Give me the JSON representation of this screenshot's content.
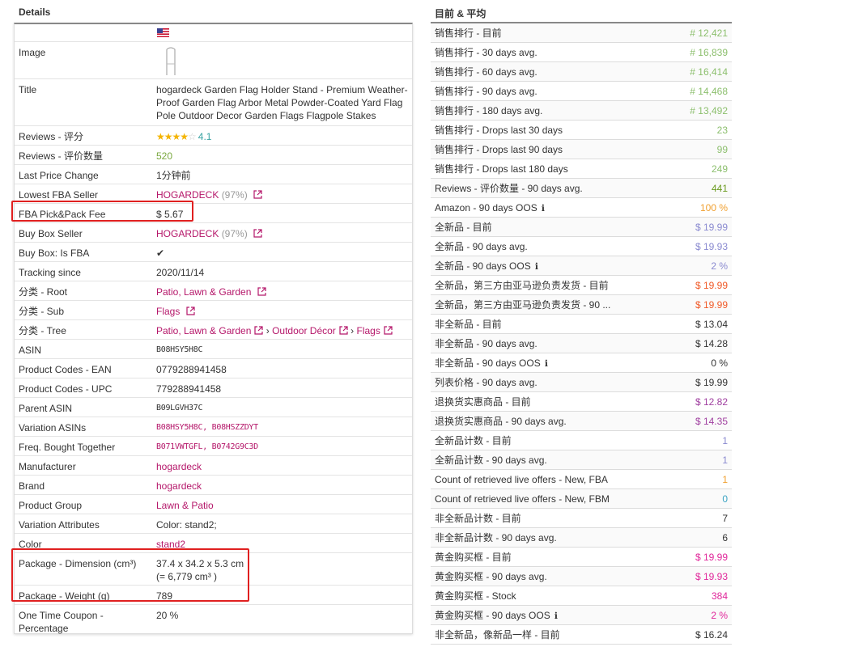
{
  "left": {
    "heading": "Details",
    "rows": [
      {
        "label": "",
        "value": ""
      },
      {
        "label": "Image",
        "value": ""
      },
      {
        "label": "Title",
        "value": "hogardeck Garden Flag Holder Stand - Premium Weather-Proof Garden Flag Arbor Metal Powder-Coated Yard Flag Pole Outdoor Decor Garden Flags Flagpole Stakes"
      },
      {
        "label": "Reviews - 评分",
        "value": "4.1",
        "stars": "★★★★",
        "stars_off": "☆"
      },
      {
        "label": "Reviews - 评价数量",
        "value": "520"
      },
      {
        "label": "Last Price Change",
        "value": "1分钟前"
      },
      {
        "label": "Lowest FBA Seller",
        "value": "HOGARDECK",
        "extra": "(97%)"
      },
      {
        "label": "FBA Pick&Pack Fee",
        "value": "$ 5.67"
      },
      {
        "label": "Buy Box Seller",
        "value": "HOGARDECK",
        "extra": "(97%)"
      },
      {
        "label": "Buy Box: Is FBA",
        "value": "✔"
      },
      {
        "label": "Tracking since",
        "value": "2020/11/14"
      },
      {
        "label": "分类 - Root",
        "value": "Patio, Lawn & Garden"
      },
      {
        "label": "分类 - Sub",
        "value": "Flags"
      },
      {
        "label": "分类 - Tree",
        "value": "Patio, Lawn & Garden",
        "value2": "Outdoor Décor",
        "value3": "Flags",
        "sep": "›"
      },
      {
        "label": "ASIN",
        "value": "B08HSY5H8C"
      },
      {
        "label": "Product Codes - EAN",
        "value": "0779288941458"
      },
      {
        "label": "Product Codes - UPC",
        "value": "779288941458"
      },
      {
        "label": "Parent ASIN",
        "value": "B09LGVH37C"
      },
      {
        "label": "Variation ASINs",
        "value": "B08HSY5H8C, B08HSZZDYT"
      },
      {
        "label": "Freq. Bought Together",
        "value": "B071VWTGFL, B0742G9C3D"
      },
      {
        "label": "Manufacturer",
        "value": "hogardeck"
      },
      {
        "label": "Brand",
        "value": "hogardeck"
      },
      {
        "label": "Product Group",
        "value": "Lawn & Patio"
      },
      {
        "label": "Variation Attributes",
        "value": "Color: stand2;"
      },
      {
        "label": "Color",
        "value": "stand2"
      },
      {
        "label": "Package - Dimension (cm³)",
        "value": "37.4 x 34.2 x 5.3 cm",
        "value_line2": "(= 6,779 cm³ )"
      },
      {
        "label": "Package - Weight (g)",
        "value": "789"
      },
      {
        "label": "One Time Coupon - Percentage",
        "value": "20 %"
      }
    ]
  },
  "right": {
    "heading": "目前 & 平均",
    "rows": [
      {
        "label": "销售排行 - 目前",
        "value": "# 12,421",
        "color": "#8cbf6d"
      },
      {
        "label": "销售排行 - 30 days avg.",
        "value": "# 16,839",
        "color": "#8cbf6d"
      },
      {
        "label": "销售排行 - 60 days avg.",
        "value": "# 16,414",
        "color": "#8cbf6d"
      },
      {
        "label": "销售排行 - 90 days avg.",
        "value": "# 14,468",
        "color": "#8cbf6d"
      },
      {
        "label": "销售排行 - 180 days avg.",
        "value": "# 13,492",
        "color": "#8cbf6d"
      },
      {
        "label": "销售排行 - Drops last 30 days",
        "value": "23",
        "color": "#8cbf6d"
      },
      {
        "label": "销售排行 - Drops last 90 days",
        "value": "99",
        "color": "#8cbf6d"
      },
      {
        "label": "销售排行 - Drops last 180 days",
        "value": "249",
        "color": "#8cbf6d"
      },
      {
        "label": "Reviews - 评价数量 - 90 days avg.",
        "value": "441",
        "color": "#6a9a1f"
      },
      {
        "label": "Amazon - 90 days OOS",
        "value": "100 %",
        "color": "#f0a030",
        "info": "ℹ"
      },
      {
        "label": "全新品 - 目前",
        "value": "$ 19.99",
        "color": "#8a8ad0"
      },
      {
        "label": "全新品 - 90 days avg.",
        "value": "$ 19.93",
        "color": "#8a8ad0"
      },
      {
        "label": "全新品 - 90 days OOS",
        "value": "2 %",
        "color": "#8a8ad0",
        "info": "ℹ"
      },
      {
        "label": "全新品，第三方由亚马逊负责发货 - 目前",
        "value": "$ 19.99",
        "color": "#f05a28"
      },
      {
        "label": "全新品，第三方由亚马逊负责发货 - 90 ...",
        "value": "$ 19.99",
        "color": "#f05a28"
      },
      {
        "label": "非全新品 - 目前",
        "value": "$ 13.04",
        "color": "#333333"
      },
      {
        "label": "非全新品 - 90 days avg.",
        "value": "$ 14.28",
        "color": "#333333"
      },
      {
        "label": "非全新品 - 90 days OOS",
        "value": "0 %",
        "color": "#333333",
        "info": "ℹ"
      },
      {
        "label": "列表价格 - 90 days avg.",
        "value": "$ 19.99",
        "color": "#333333"
      },
      {
        "label": "退换货实惠商品 - 目前",
        "value": "$ 12.82",
        "color": "#a040a0"
      },
      {
        "label": "退换货实惠商品 - 90 days avg.",
        "value": "$ 14.35",
        "color": "#a040a0"
      },
      {
        "label": "全新品计数 - 目前",
        "value": "1",
        "color": "#8a8ad0"
      },
      {
        "label": "全新品计数 - 90 days avg.",
        "value": "1",
        "color": "#8a8ad0"
      },
      {
        "label": "Count of retrieved live offers - New, FBA",
        "value": "1",
        "color": "#f0a030"
      },
      {
        "label": "Count of retrieved live offers - New, FBM",
        "value": "0",
        "color": "#3aa3c3"
      },
      {
        "label": "非全新品计数 - 目前",
        "value": "7",
        "color": "#333333"
      },
      {
        "label": "非全新品计数 - 90 days avg.",
        "value": "6",
        "color": "#333333"
      },
      {
        "label": "黄金购买框 - 目前",
        "value": "$ 19.99",
        "color": "#e0279a"
      },
      {
        "label": "黄金购买框 - 90 days avg.",
        "value": "$ 19.93",
        "color": "#e0279a"
      },
      {
        "label": "黄金购买框 - Stock",
        "value": "384",
        "color": "#e0279a"
      },
      {
        "label": "黄金购买框 - 90 days OOS",
        "value": "2 %",
        "color": "#e0279a",
        "info": "ℹ"
      },
      {
        "label": "非全新品，像新品一样 - 目前",
        "value": "$ 16.24",
        "color": "#333333"
      }
    ]
  }
}
